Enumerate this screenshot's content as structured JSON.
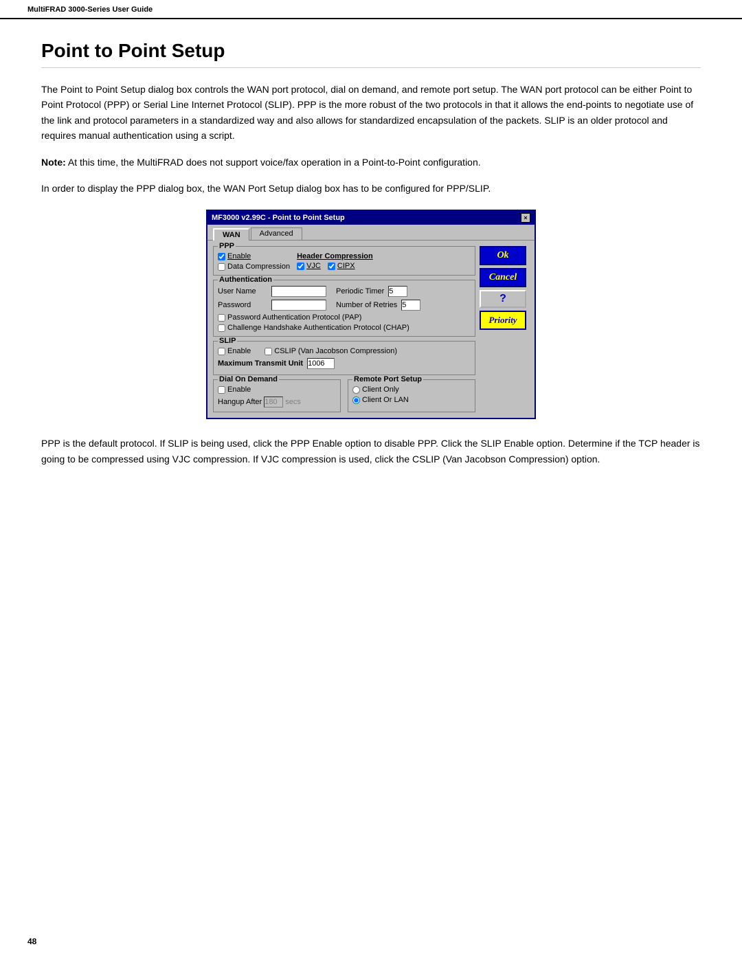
{
  "header": {
    "title": "MultiFRAD 3000-Series User Guide"
  },
  "page": {
    "title": "Point to Point Setup",
    "intro": "The Point to Point Setup dialog box controls the WAN port protocol, dial on demand, and remote port setup.  The WAN port protocol can be either Point to Point Protocol (PPP) or Serial Line Internet Protocol (SLIP).  PPP is the more robust of the two protocols in that it allows the end-points to negotiate use of the link and protocol parameters in a standardized way and also allows for standardized encapsulation of the packets.  SLIP is an older protocol and requires manual authentication using a script.",
    "note_label": "Note:",
    "note_text": " At this time, the MultiFRAD does not support voice/fax operation in a Point-to-Point configuration.",
    "slip_note": "In order to display the PPP dialog box, the WAN Port Setup dialog box has to be configured for PPP/SLIP.",
    "closing": "PPP is the default protocol.  If SLIP is being used, click the PPP Enable option to disable PPP. Click the SLIP Enable option. Determine if the TCP header is going to be compressed using VJC compression. If VJC compression is used, click the CSLIP (Van Jacobson Compression) option."
  },
  "dialog": {
    "title": "MF3000 v2.99C - Point to Point Setup",
    "close_btn": "×",
    "tabs": [
      {
        "label": "WAN",
        "active": true
      },
      {
        "label": "Advanced",
        "active": false
      }
    ],
    "ppp_section": {
      "label": "PPP",
      "enable_checked": true,
      "enable_label": "Enable",
      "data_compression_checked": false,
      "data_compression_label": "Data Compression",
      "header_compression_label": "Header Compression",
      "vjc_checked": true,
      "vjc_label": "VJC",
      "cipx_checked": true,
      "cipx_label": "CIPX"
    },
    "auth_section": {
      "label": "Authentication",
      "username_label": "User Name",
      "password_label": "Password",
      "periodic_timer_label": "Periodic Timer",
      "periodic_timer_value": "5",
      "retries_label": "Number of Retries",
      "retries_value": "5",
      "pap_label": "Password Authentication Protocol (PAP)",
      "pap_checked": false,
      "chap_label": "Challenge Handshake Authentication Protocol (CHAP)",
      "chap_checked": false
    },
    "slip_section": {
      "label": "SLIP",
      "enable_checked": false,
      "enable_label": "Enable",
      "cslip_checked": false,
      "cslip_label": "CSLIP (Van Jacobson Compression)",
      "mtu_label": "Maximum Transmit Unit",
      "mtu_value": "1006"
    },
    "dial_demand": {
      "label": "Dial On Demand",
      "enable_checked": false,
      "enable_label": "Enable",
      "hangup_label": "Hangup After",
      "hangup_value": "180",
      "secs_label": "secs"
    },
    "remote_port": {
      "label": "Remote Port Setup",
      "client_only_label": "Client Only",
      "client_only_checked": false,
      "client_lan_label": "Client Or LAN",
      "client_lan_checked": true
    },
    "buttons": {
      "ok": "Ok",
      "cancel": "Cancel",
      "help": "?",
      "priority": "Priority"
    }
  },
  "footer": {
    "page_number": "48"
  }
}
